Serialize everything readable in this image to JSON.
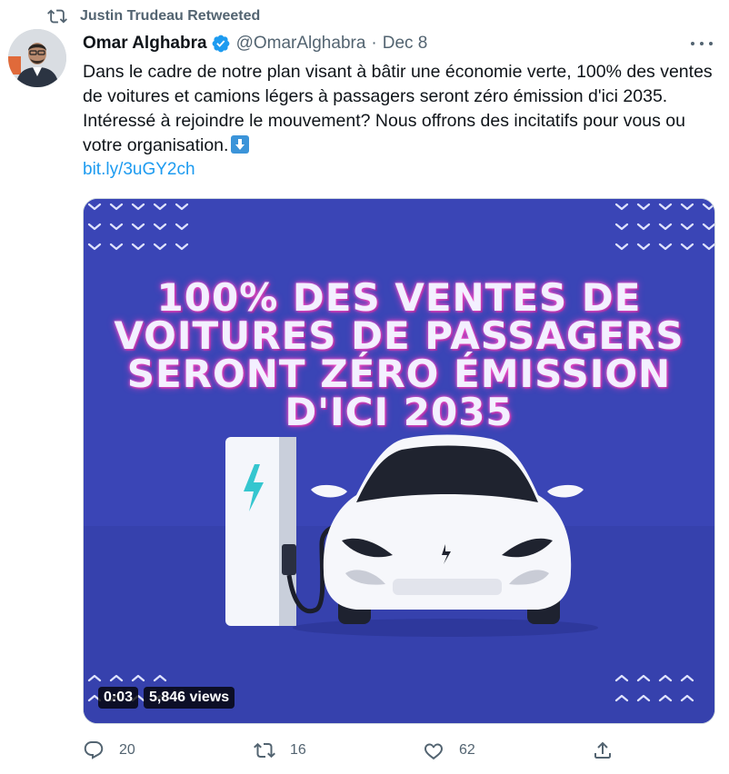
{
  "retweet": {
    "text": "Justin Trudeau Retweeted",
    "icon": "retweet-icon"
  },
  "tweet": {
    "author_name": "Omar Alghabra",
    "verified": true,
    "handle": "@OmarAlghabra",
    "separator": "·",
    "date": "Dec 8",
    "body": "Dans le cadre de notre plan visant à bâtir une économie verte, 100% des ventes de voitures et camions légers à passagers seront zéro émission d'ici 2035. Intéressé à rejoindre le mouvement? Nous offrons des incitatifs pour vous ou votre organisation.",
    "emoji": "down-arrow-emoji",
    "link": "bit.ly/3uGY2ch"
  },
  "media": {
    "title_lines": [
      "100% DES VENTES DE",
      "VOITURES DE PASSAGERS",
      "SERONT ZÉRO ÉMISSION",
      "D'ICI 2035"
    ],
    "time": "0:03",
    "views": "5,846 views",
    "bg_color": "#3a45b6"
  },
  "actions": {
    "replies": "20",
    "retweets": "16",
    "likes": "62"
  },
  "colors": {
    "accent": "#1d9bf0",
    "muted": "#536471",
    "text": "#0f1419"
  }
}
